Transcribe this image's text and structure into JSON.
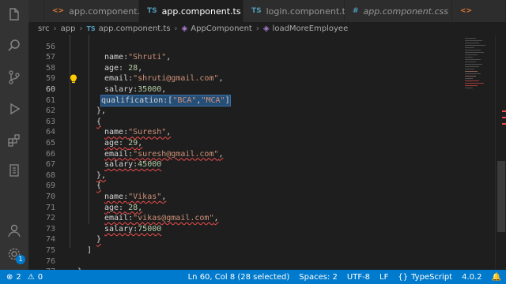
{
  "tabs": [
    {
      "label": "app.component.html",
      "icon": "html-file-icon",
      "active": false
    },
    {
      "label": "app.component.ts",
      "icon": "ts-file-icon",
      "active": true,
      "modified": true
    },
    {
      "label": "login.component.ts",
      "icon": "ts-file-icon",
      "active": false
    },
    {
      "label": "app.component.css",
      "icon": "css-file-icon",
      "active": false
    }
  ],
  "tab_icons": {
    "ts": "TS",
    "html": "<>",
    "css": "#"
  },
  "breadcrumb": {
    "items": [
      "src",
      "app",
      "app.component.ts",
      "AppComponent",
      "loadMoreEmployee"
    ]
  },
  "editor": {
    "lines": [
      {
        "n": "56",
        "text": "name:\"Shruti\","
      },
      {
        "n": "57",
        "text": "age: 28,"
      },
      {
        "n": "58",
        "text": "email:\"shruti@gmail.com\","
      },
      {
        "n": "59",
        "text": "salary:35000,"
      },
      {
        "n": "60",
        "text": "qualification:[\"BCA\",\"MCA\"]"
      },
      {
        "n": "61",
        "text": "},"
      },
      {
        "n": "62",
        "text": "{"
      },
      {
        "n": "63",
        "text": "name:\"Suresh\","
      },
      {
        "n": "64",
        "text": "age: 29,"
      },
      {
        "n": "65",
        "text": "email:\"suresh@gmail.com\","
      },
      {
        "n": "66",
        "text": "salary:45000"
      },
      {
        "n": "67",
        "text": "},"
      },
      {
        "n": "68",
        "text": "{"
      },
      {
        "n": "69",
        "text": "name:\"Vikas\","
      },
      {
        "n": "70",
        "text": "age: 28,"
      },
      {
        "n": "71",
        "text": "email:\"vikas@gmail.com\","
      },
      {
        "n": "72",
        "text": "salary:75000"
      },
      {
        "n": "73",
        "text": "}"
      },
      {
        "n": "74",
        "text": "]"
      },
      {
        "n": "75",
        "text": ""
      },
      {
        "n": "76",
        "text": "}"
      },
      {
        "n": "77",
        "text": ""
      }
    ],
    "current_line": "60"
  },
  "statusbar": {
    "problems_errors": "2",
    "problems_warnings": "0",
    "cursor": "Ln 60, Col 8 (28 selected)",
    "spaces": "Spaces: 2",
    "encoding": "UTF-8",
    "eol": "LF",
    "language": "TypeScript",
    "version": "4.0.2"
  },
  "activity_bar": {
    "icons": [
      "explorer-icon",
      "search-icon",
      "source-control-icon",
      "run-debug-icon",
      "extensions-icon",
      "testing-icon",
      "account-icon",
      "settings-icon"
    ],
    "settings_badge": "1"
  },
  "colors": {
    "accent": "#007acc",
    "string": "#ce9178",
    "number": "#b5cea8",
    "selection": "#264f78",
    "error": "#f14c4c"
  }
}
